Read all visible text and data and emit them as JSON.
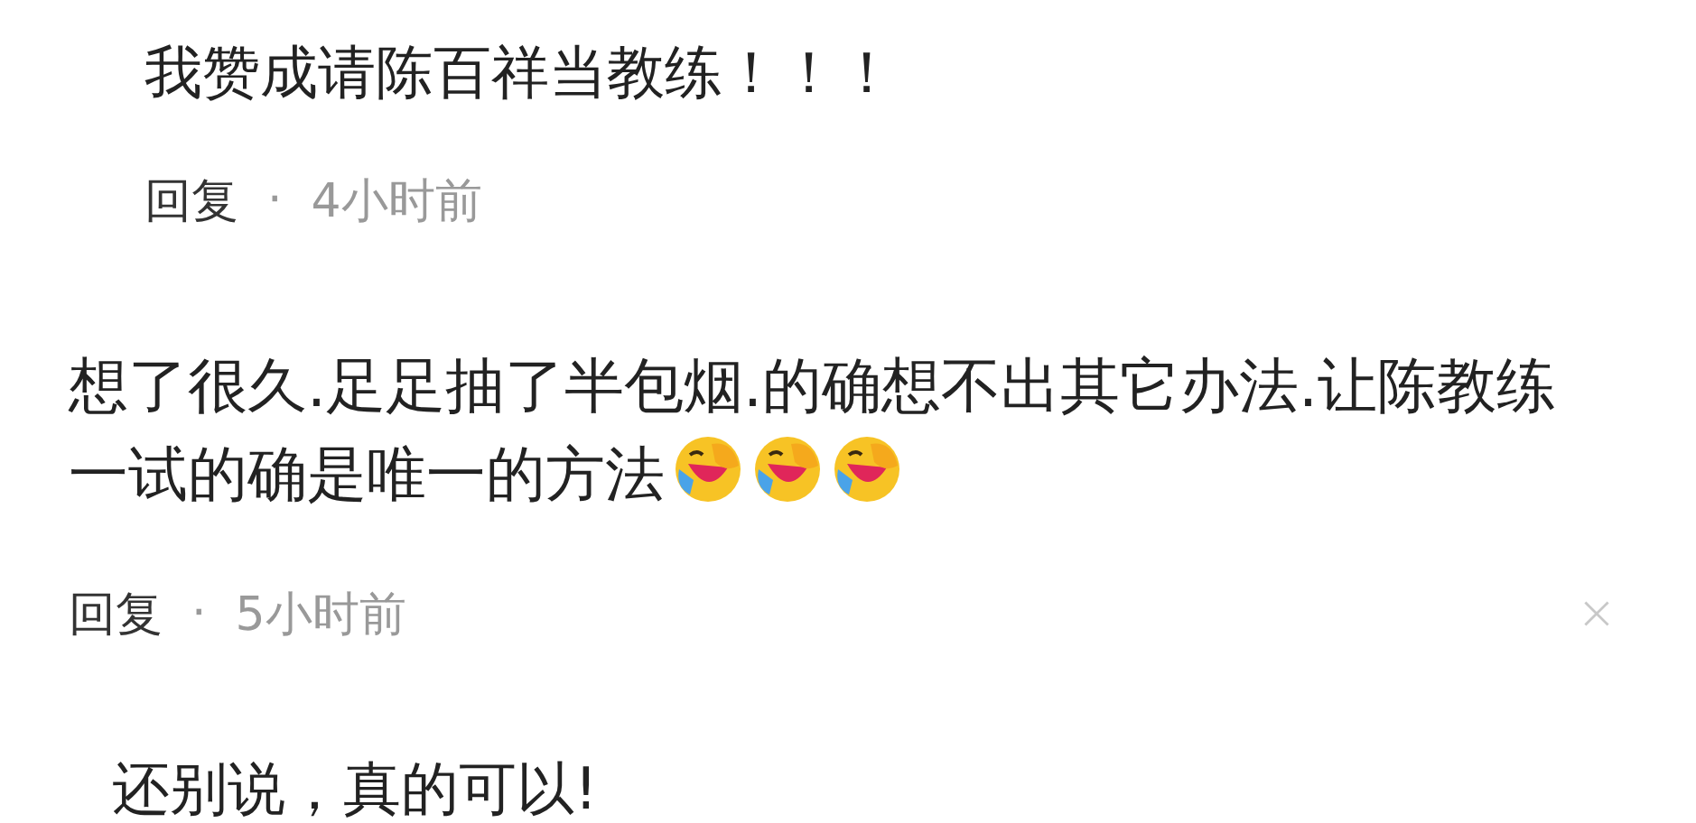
{
  "comments": [
    {
      "text": "我赞成请陈百祥当教练！！！",
      "reply": {
        "label": "回复",
        "separator": "·",
        "time": "4小时前"
      }
    },
    {
      "text": "想了很久.足足抽了半包烟.的确想不出其它办法.让陈教练一试的确是唯一的方法",
      "emojis": [
        {
          "kind": "laughing-crying"
        },
        {
          "kind": "laughing-crying"
        },
        {
          "kind": "laughing-crying"
        }
      ],
      "reply": {
        "label": "回复",
        "separator": "·",
        "time": "5小时前"
      },
      "closable": true
    },
    {
      "text": "还别说，真的可以!"
    }
  ]
}
